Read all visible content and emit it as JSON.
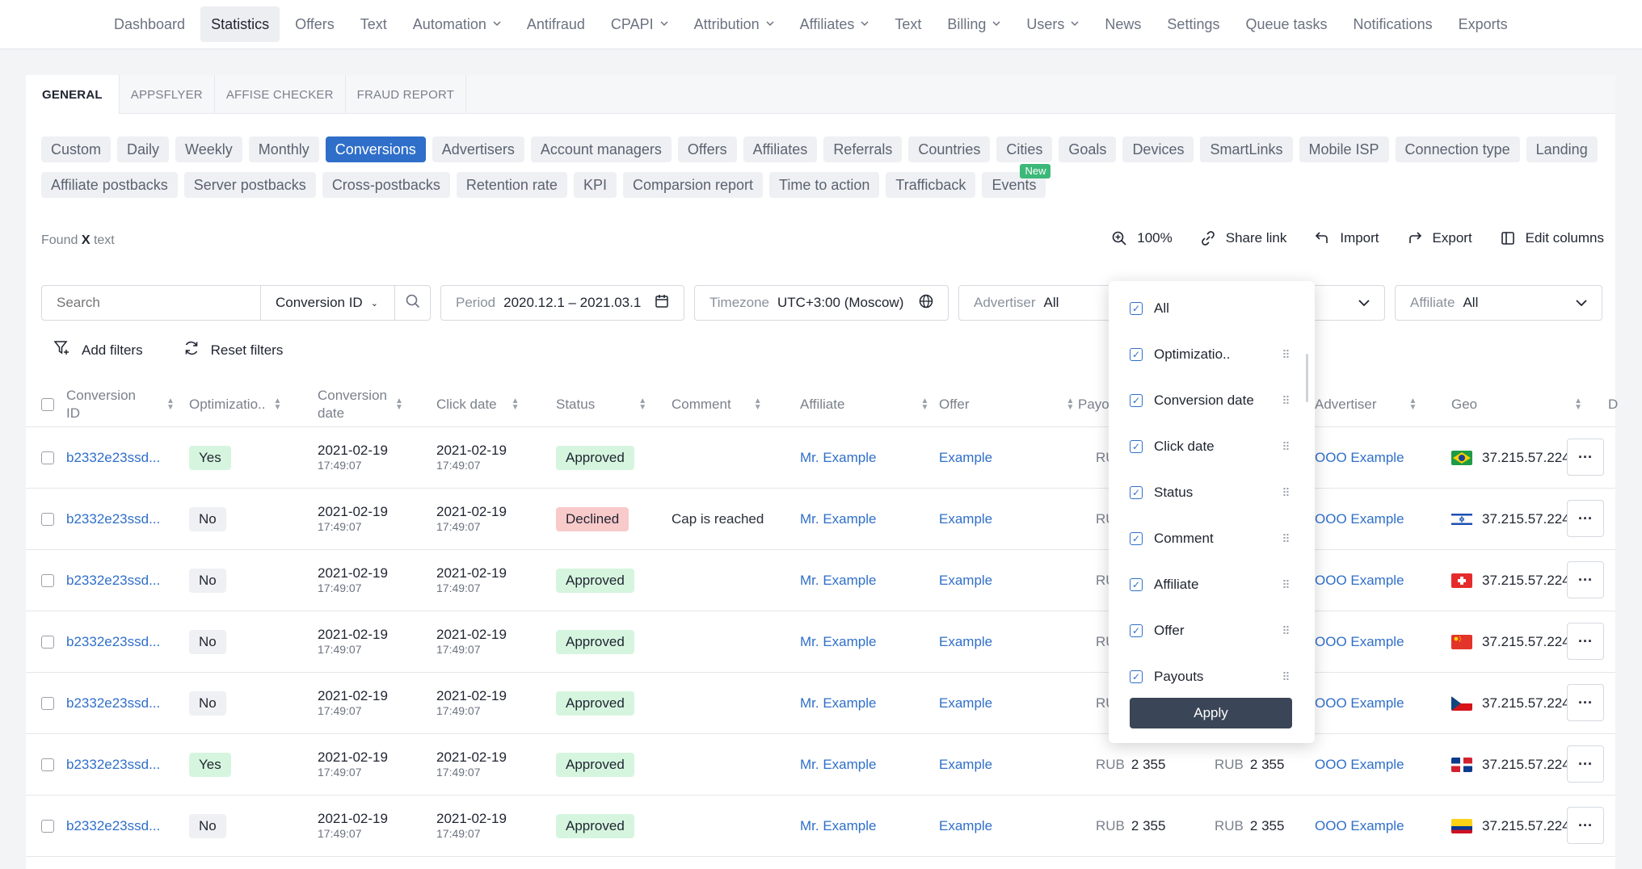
{
  "topnav": {
    "items": [
      {
        "label": "Dashboard",
        "active": false,
        "dropdown": false
      },
      {
        "label": "Statistics",
        "active": true,
        "dropdown": false
      },
      {
        "label": "Offers",
        "active": false,
        "dropdown": false
      },
      {
        "label": "Text",
        "active": false,
        "dropdown": false
      },
      {
        "label": "Automation",
        "active": false,
        "dropdown": true
      },
      {
        "label": "Antifraud",
        "active": false,
        "dropdown": false
      },
      {
        "label": "CPAPI",
        "active": false,
        "dropdown": true
      },
      {
        "label": "Attribution",
        "active": false,
        "dropdown": true
      },
      {
        "label": "Affiliates",
        "active": false,
        "dropdown": true
      },
      {
        "label": "Text",
        "active": false,
        "dropdown": false
      },
      {
        "label": "Billing",
        "active": false,
        "dropdown": true
      },
      {
        "label": "Users",
        "active": false,
        "dropdown": true
      },
      {
        "label": "News",
        "active": false,
        "dropdown": false
      },
      {
        "label": "Settings",
        "active": false,
        "dropdown": false
      },
      {
        "label": "Queue tasks",
        "active": false,
        "dropdown": false
      },
      {
        "label": "Notifications",
        "active": false,
        "dropdown": false
      },
      {
        "label": "Exports",
        "active": false,
        "dropdown": false
      }
    ]
  },
  "tabs": [
    "GENERAL",
    "APPSFLYER",
    "AFFISE CHECKER",
    "FRAUD REPORT"
  ],
  "chips": {
    "row1": [
      "Custom",
      "Daily",
      "Weekly",
      "Monthly",
      "Conversions",
      "Advertisers",
      "Account managers",
      "Offers",
      "Affiliates",
      "Referrals",
      "Countries",
      "Cities",
      "Goals",
      "Devices",
      "SmartLinks",
      "Mobile ISP",
      "Connection type",
      "Landing"
    ],
    "row2": [
      "Affiliate postbacks",
      "Server postbacks",
      "Cross-postbacks",
      "Retention rate",
      "KPI",
      "Comparsion report",
      "Time to action",
      "Trafficback",
      "Events"
    ],
    "active": "Conversions",
    "new_badge": "New"
  },
  "found": {
    "prefix": "Found",
    "count": "X",
    "suffix": "text"
  },
  "toolbar": {
    "zoom": "100%",
    "share": "Share link",
    "import": "Import",
    "export": "Export",
    "edit_columns": "Edit columns"
  },
  "filters": {
    "search_placeholder": "Search",
    "search_field": "Conversion ID",
    "period_label": "Period",
    "period_value": "2020.12.1 – 2021.03.1",
    "timezone_label": "Timezone",
    "timezone_value": "UTC+3:00 (Moscow)",
    "advertiser_label": "Advertiser",
    "advertiser_value": "All",
    "affiliate_label": "Affiliate",
    "affiliate_value": "All",
    "add_filters": "Add filters",
    "reset_filters": "Reset filters"
  },
  "table": {
    "headers": {
      "conv_id_1": "Conversion",
      "conv_id_2": "ID",
      "optim": "Optimizatio..",
      "conv_date_1": "Conversion",
      "conv_date_2": "date",
      "click_date": "Click date",
      "status": "Status",
      "comment": "Comment",
      "affiliate": "Affiliate",
      "offer": "Offer",
      "payouts": "Payo",
      "advertiser": "Advertiser",
      "geo": "Geo",
      "extra": "D"
    },
    "rows": [
      {
        "id": "b2332e23ssd...",
        "optim": "Yes",
        "conv_date": "2021-02-19",
        "conv_time": "17:49:07",
        "click_date": "2021-02-19",
        "click_time": "17:49:07",
        "status": "Approved",
        "comment": "",
        "affiliate": "Mr. Example",
        "offer": "Example",
        "pay_cur": "RUB",
        "pay_amt": "",
        "rev_cur": "",
        "rev_amt": "",
        "advertiser": "OOO Example",
        "flag": "br",
        "ip": "37.215.57.224"
      },
      {
        "id": "b2332e23ssd...",
        "optim": "No",
        "conv_date": "2021-02-19",
        "conv_time": "17:49:07",
        "click_date": "2021-02-19",
        "click_time": "17:49:07",
        "status": "Declined",
        "comment": "Cap is reached",
        "affiliate": "Mr. Example",
        "offer": "Example",
        "pay_cur": "RUB",
        "pay_amt": "",
        "rev_cur": "",
        "rev_amt": "",
        "advertiser": "OOO Example",
        "flag": "il",
        "ip": "37.215.57.224"
      },
      {
        "id": "b2332e23ssd...",
        "optim": "No",
        "conv_date": "2021-02-19",
        "conv_time": "17:49:07",
        "click_date": "2021-02-19",
        "click_time": "17:49:07",
        "status": "Approved",
        "comment": "",
        "affiliate": "Mr. Example",
        "offer": "Example",
        "pay_cur": "RUB",
        "pay_amt": "",
        "rev_cur": "",
        "rev_amt": "",
        "advertiser": "OOO Example",
        "flag": "ch",
        "ip": "37.215.57.224"
      },
      {
        "id": "b2332e23ssd...",
        "optim": "No",
        "conv_date": "2021-02-19",
        "conv_time": "17:49:07",
        "click_date": "2021-02-19",
        "click_time": "17:49:07",
        "status": "Approved",
        "comment": "",
        "affiliate": "Mr. Example",
        "offer": "Example",
        "pay_cur": "RUB",
        "pay_amt": "",
        "rev_cur": "",
        "rev_amt": "",
        "advertiser": "OOO Example",
        "flag": "cn",
        "ip": "37.215.57.224"
      },
      {
        "id": "b2332e23ssd...",
        "optim": "No",
        "conv_date": "2021-02-19",
        "conv_time": "17:49:07",
        "click_date": "2021-02-19",
        "click_time": "17:49:07",
        "status": "Approved",
        "comment": "",
        "affiliate": "Mr. Example",
        "offer": "Example",
        "pay_cur": "RUB",
        "pay_amt": "",
        "rev_cur": "",
        "rev_amt": "",
        "advertiser": "OOO Example",
        "flag": "cz",
        "ip": "37.215.57.224"
      },
      {
        "id": "b2332e23ssd...",
        "optim": "Yes",
        "conv_date": "2021-02-19",
        "conv_time": "17:49:07",
        "click_date": "2021-02-19",
        "click_time": "17:49:07",
        "status": "Approved",
        "comment": "",
        "affiliate": "Mr. Example",
        "offer": "Example",
        "pay_cur": "RUB",
        "pay_amt": "2 355",
        "rev_cur": "RUB",
        "rev_amt": "2 355",
        "advertiser": "OOO Example",
        "flag": "do",
        "ip": "37.215.57.224"
      },
      {
        "id": "b2332e23ssd...",
        "optim": "No",
        "conv_date": "2021-02-19",
        "conv_time": "17:49:07",
        "click_date": "2021-02-19",
        "click_time": "17:49:07",
        "status": "Approved",
        "comment": "",
        "affiliate": "Mr. Example",
        "offer": "Example",
        "pay_cur": "RUB",
        "pay_amt": "2 355",
        "rev_cur": "RUB",
        "rev_amt": "2 355",
        "advertiser": "OOO Example",
        "flag": "co",
        "ip": "37.215.57.224"
      }
    ]
  },
  "column_popup": {
    "items": [
      "All",
      "Optimizatio..",
      "Conversion date",
      "Click date",
      "Status",
      "Comment",
      "Affiliate",
      "Offer",
      "Payouts"
    ],
    "apply": "Apply"
  },
  "colors": {
    "accent": "#2f6fc9",
    "approved_bg": "#d6f5df",
    "declined_bg": "#f8caca",
    "apply_bg": "#3a4557"
  }
}
